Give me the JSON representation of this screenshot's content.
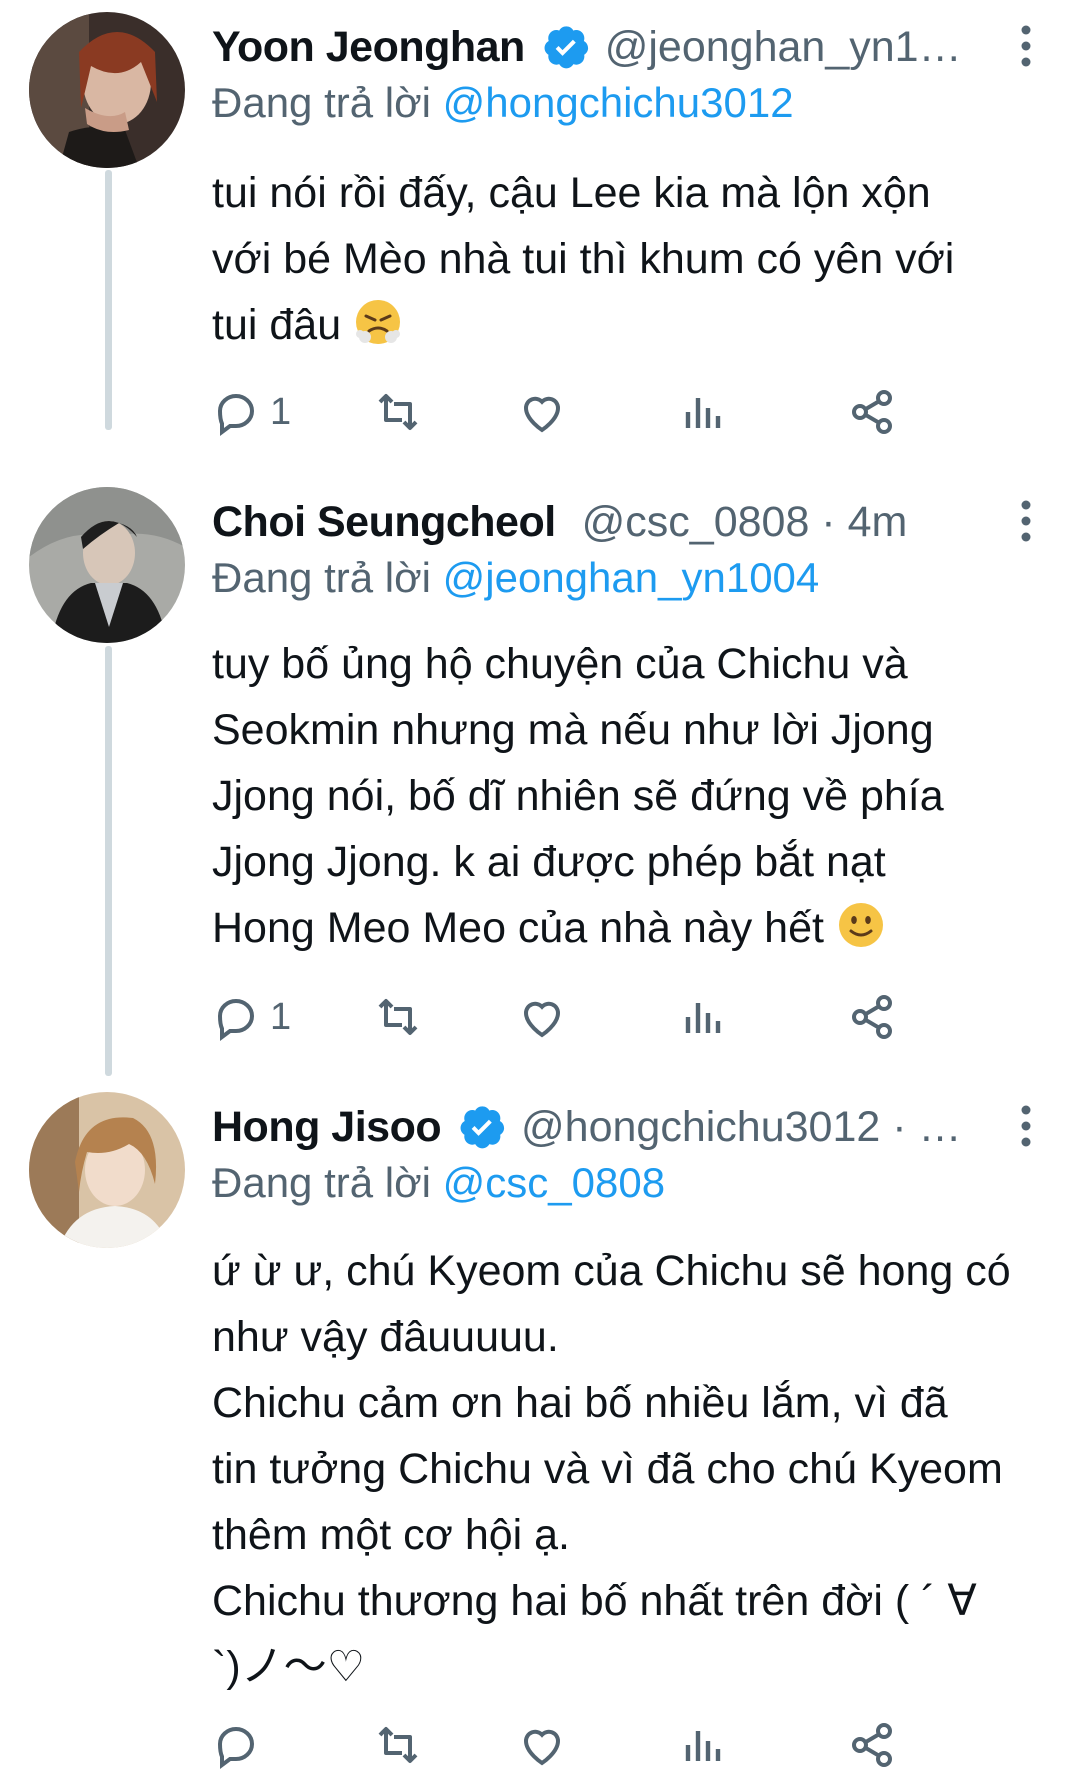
{
  "tweets": [
    {
      "name": "Yoon Jeonghan",
      "verified": true,
      "handle": "@jeonghan_yn1…",
      "reply_prefix": "Đang trả lời",
      "reply_to": "@hongchichu3012",
      "body": [
        "tui nói rồi đấy, cậu Lee kia mà lộn xộn",
        "với bé Mèo nhà tui thì khum có yên với",
        "tui đâu"
      ],
      "emoji": "angry-steam-face",
      "reply_count": "1"
    },
    {
      "name": "Choi Seungcheol",
      "verified": false,
      "handle": "@csc_0808 · 4m",
      "reply_prefix": "Đang trả lời",
      "reply_to": "@jeonghan_yn1004",
      "body": [
        "tuy bố ủng hộ chuyện của Chichu và",
        "Seokmin nhưng mà nếu như lời Jjong",
        "Jjong nói, bố dĩ nhiên sẽ đứng về phía",
        "Jjong Jjong. k ai được phép bắt nạt",
        "Hong Meo Meo của nhà này hết"
      ],
      "emoji": "slight-smile-face",
      "reply_count": "1"
    },
    {
      "name": "Hong Jisoo",
      "verified": true,
      "handle": "@hongchichu3012 · …",
      "reply_prefix": "Đang trả lời",
      "reply_to": "@csc_0808",
      "body": [
        "ứ ừ ư, chú Kyeom của Chichu sẽ hong có",
        "như vậy đâuuuuu.",
        "Chichu cảm ơn hai bố nhiều lắm, vì đã",
        "tin tưởng Chichu và vì đã cho chú Kyeom",
        "thêm một cơ hội ạ.",
        "Chichu thương hai bố nhất trên đời ( ´ ∀",
        "`)ノ～♡"
      ],
      "emoji": "",
      "reply_count": ""
    }
  ],
  "icons": {
    "reply": "reply-icon",
    "retweet": "retweet-icon",
    "like": "heart-icon",
    "views": "views-icon",
    "share": "share-icon",
    "more": "more-options-icon",
    "verified": "verified-badge-icon"
  },
  "colors": {
    "link": "#1d9bf0",
    "secondary_text": "#536471",
    "thread_line": "#cfd9de",
    "verified": "#1d9bf0"
  }
}
